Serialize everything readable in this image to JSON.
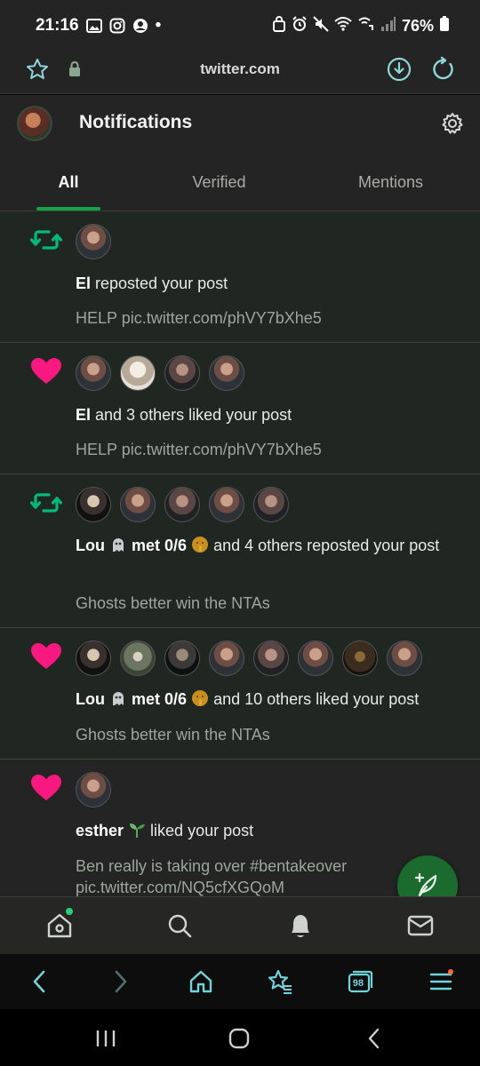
{
  "status": {
    "time": "21:16",
    "dot": "•",
    "battery": "76%"
  },
  "browser": {
    "url": "twitter.com",
    "tab_count": "98"
  },
  "header": {
    "title": "Notifications"
  },
  "tabs": [
    {
      "label": "All",
      "active": true
    },
    {
      "label": "Verified",
      "active": false
    },
    {
      "label": "Mentions",
      "active": false
    }
  ],
  "notifications": [
    {
      "kind": "repost",
      "actor": "El",
      "action": " reposted your post",
      "post": "HELP pic.twitter.com/phVY7bXhe5"
    },
    {
      "kind": "like",
      "actor": "El",
      "action": " and 3 others liked your post",
      "post": "HELP pic.twitter.com/phVY7bXhe5"
    },
    {
      "kind": "repost",
      "actor": "Lou",
      "actor2": "met 0/6",
      "action": " and 4 others reposted your post",
      "post": "Ghosts better win the NTAs"
    },
    {
      "kind": "like",
      "actor": "Lou",
      "actor2": "met 0/6",
      "action": " and 10 others liked your post",
      "post": "Ghosts better win the NTAs"
    },
    {
      "kind": "like",
      "actor": "esther",
      "action": " liked your post",
      "post": "Ben really is taking over #bentakeover pic.twitter.com/NQ5cfXGQoM"
    }
  ],
  "colors": {
    "accent": "#17a34a",
    "like": "#f91880",
    "repost": "#00ba7c",
    "fab": "#1b6b2e"
  }
}
